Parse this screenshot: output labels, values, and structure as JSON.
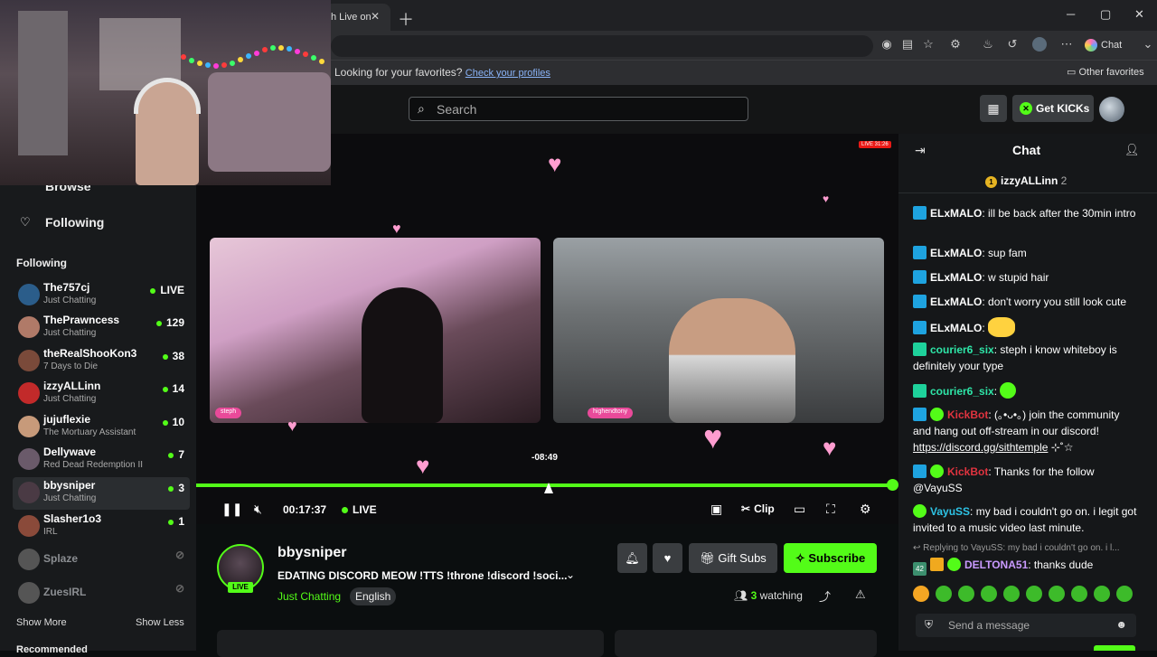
{
  "browser": {
    "tab_title": "h Live on",
    "favorites_prompt": "Looking for your favorites?",
    "favorites_link": "Check your profiles",
    "other_favorites": "Other favorites",
    "copilot_label": "Chat"
  },
  "header": {
    "search_placeholder": "Search",
    "get_kicks": "Get KICKs"
  },
  "sidebar": {
    "nav": [
      {
        "label": "Browse"
      },
      {
        "label": "Following"
      }
    ],
    "following_header": "Following",
    "channels": [
      {
        "name": "The757cj",
        "category": "Just Chatting",
        "viewers": "LIVE",
        "avatar_color": "#2b5d8a"
      },
      {
        "name": "ThePrawncess",
        "category": "Just Chatting",
        "viewers": "129",
        "avatar_color": "#b07a68"
      },
      {
        "name": "theRealShooKon3",
        "category": "7 Days to Die",
        "viewers": "38",
        "avatar_color": "#7a4a3a"
      },
      {
        "name": "izzyALLinn",
        "category": "Just Chatting",
        "viewers": "14",
        "avatar_color": "#c22a2a"
      },
      {
        "name": "jujuflexie",
        "category": "The Mortuary Assistant",
        "viewers": "10",
        "avatar_color": "#c79a7a"
      },
      {
        "name": "Dellywave",
        "category": "Red Dead Redemption II",
        "viewers": "7",
        "avatar_color": "#6a5a6a"
      },
      {
        "name": "bbysniper",
        "category": "Just Chatting",
        "viewers": "3",
        "avatar_color": "#4a3a44"
      },
      {
        "name": "Slasher1o3",
        "category": "IRL",
        "viewers": "1",
        "avatar_color": "#8a4a3a"
      },
      {
        "name": "Splaze",
        "category": "",
        "viewers": "",
        "avatar_color": "#555"
      },
      {
        "name": "ZuesIRL",
        "category": "",
        "viewers": "",
        "avatar_color": "#555"
      }
    ],
    "show_more": "Show More",
    "show_less": "Show Less",
    "recommended": "Recommended"
  },
  "player": {
    "live_badge": "LIVE 31:26",
    "cam1_tag": "steph",
    "cam2_tag": "highendtony",
    "tooltip_time": "-08:49",
    "timecode": "00:17:37",
    "live_label": "LIVE",
    "clip_label": "Clip",
    "progress_fraction": 1.0
  },
  "stream": {
    "name": "bbysniper",
    "title": "EDATING DISCORD MEOW !TTS !throne !discord !soci...",
    "category": "Just Chatting",
    "language": "English",
    "live_pill": "LIVE",
    "gift_subs": "Gift Subs",
    "subscribe": "Subscribe",
    "watching_count": "3",
    "watching_label": "watching"
  },
  "chat": {
    "title": "Chat",
    "pinned_user": "izzyALLinn",
    "pinned_count": "2",
    "messages": [
      {
        "user": "ELxMALO",
        "color": "#ffffff",
        "text": "ill be back after the 30min intro"
      },
      {
        "user": "ELxMALO",
        "color": "#ffffff",
        "text": "sup fam"
      },
      {
        "user": "ELxMALO",
        "color": "#ffffff",
        "text": "w stupid hair"
      },
      {
        "user": "ELxMALO",
        "color": "#ffffff",
        "text": "don't worry you still look cute"
      },
      {
        "user": "ELxMALO",
        "color": "#ffffff",
        "text": ""
      },
      {
        "user": "courier6_six",
        "color": "#2ee6a8",
        "text": "steph i know whiteboy is definitely your type"
      },
      {
        "user": "courier6_six",
        "color": "#2ee6a8",
        "text": ""
      },
      {
        "user": "KickBot",
        "color": "#e0333f",
        "text": "(｡•ᴗ•｡) join the community and hang out off-stream in our discord!",
        "link": "https://discord.gg/sithtemple",
        "suffix": " ⊹˚☆"
      },
      {
        "user": "KickBot",
        "color": "#e0333f",
        "text": "Thanks for the follow @VayuSS"
      },
      {
        "user": "VayuSS",
        "color": "#2ec4e6",
        "text": "my bad i couldn't go on. i legit got invited to a music video last minute."
      },
      {
        "user": "DELTONA51",
        "color": "#c99aff",
        "text": "thanks dude"
      }
    ],
    "reply_text": "Replying to VayuSS: my bad i couldn't go on. i l...",
    "badge_num": "42",
    "input_placeholder": "Send a message"
  },
  "colors": {
    "brand": "#53fc18",
    "background": "#0b0e0f",
    "panel": "#3a3d40"
  }
}
